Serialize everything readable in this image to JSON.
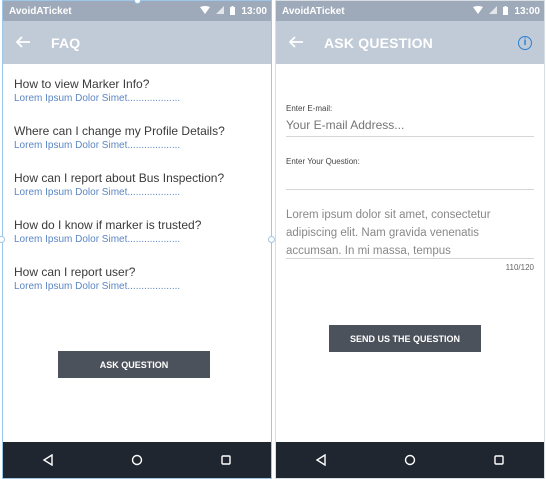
{
  "statusbar": {
    "app_name": "AvoidATicket",
    "time": "13:00"
  },
  "faq_screen": {
    "title": "FAQ",
    "items": [
      {
        "question": "How to view Marker Info?",
        "answer": "Lorem Ipsum Dolor Simet..................."
      },
      {
        "question": "Where can I change my Profile Details?",
        "answer": "Lorem Ipsum Dolor Simet..................."
      },
      {
        "question": "How can I report about Bus Inspection?",
        "answer": "Lorem Ipsum Dolor Simet..................."
      },
      {
        "question": "How do I know if marker is trusted?",
        "answer": "Lorem Ipsum Dolor Simet..................."
      },
      {
        "question": "How can I report user?",
        "answer": "Lorem Ipsum Dolor Simet..................."
      }
    ],
    "ask_button_label": "ASK QUESTION"
  },
  "ask_screen": {
    "title": "ASK QUESTION",
    "info_icon": "i",
    "email_label": "Enter E-mail:",
    "email_placeholder": "Your E-mail Address...",
    "question_label": "Enter Your Question:",
    "question_value": "Lorem ipsum dolor sit amet, consectetur adipiscing elit. Nam gravida venenatis accumsan. In mi massa, tempus",
    "counter": "110/120",
    "send_button_label": "SEND US THE QUESTION"
  },
  "icons": {
    "back": "arrow-left-icon",
    "info": "info-icon",
    "nav_back": "triangle-back-icon",
    "nav_home": "circle-home-icon",
    "nav_recents": "square-recents-icon"
  },
  "colors": {
    "status_bar": "#9eaab9",
    "app_bar": "#c1cbd7",
    "nav_bar": "#20262f",
    "button": "#4c525b",
    "answer_text": "#5b86c4",
    "info_icon": "#2a7fd2"
  }
}
